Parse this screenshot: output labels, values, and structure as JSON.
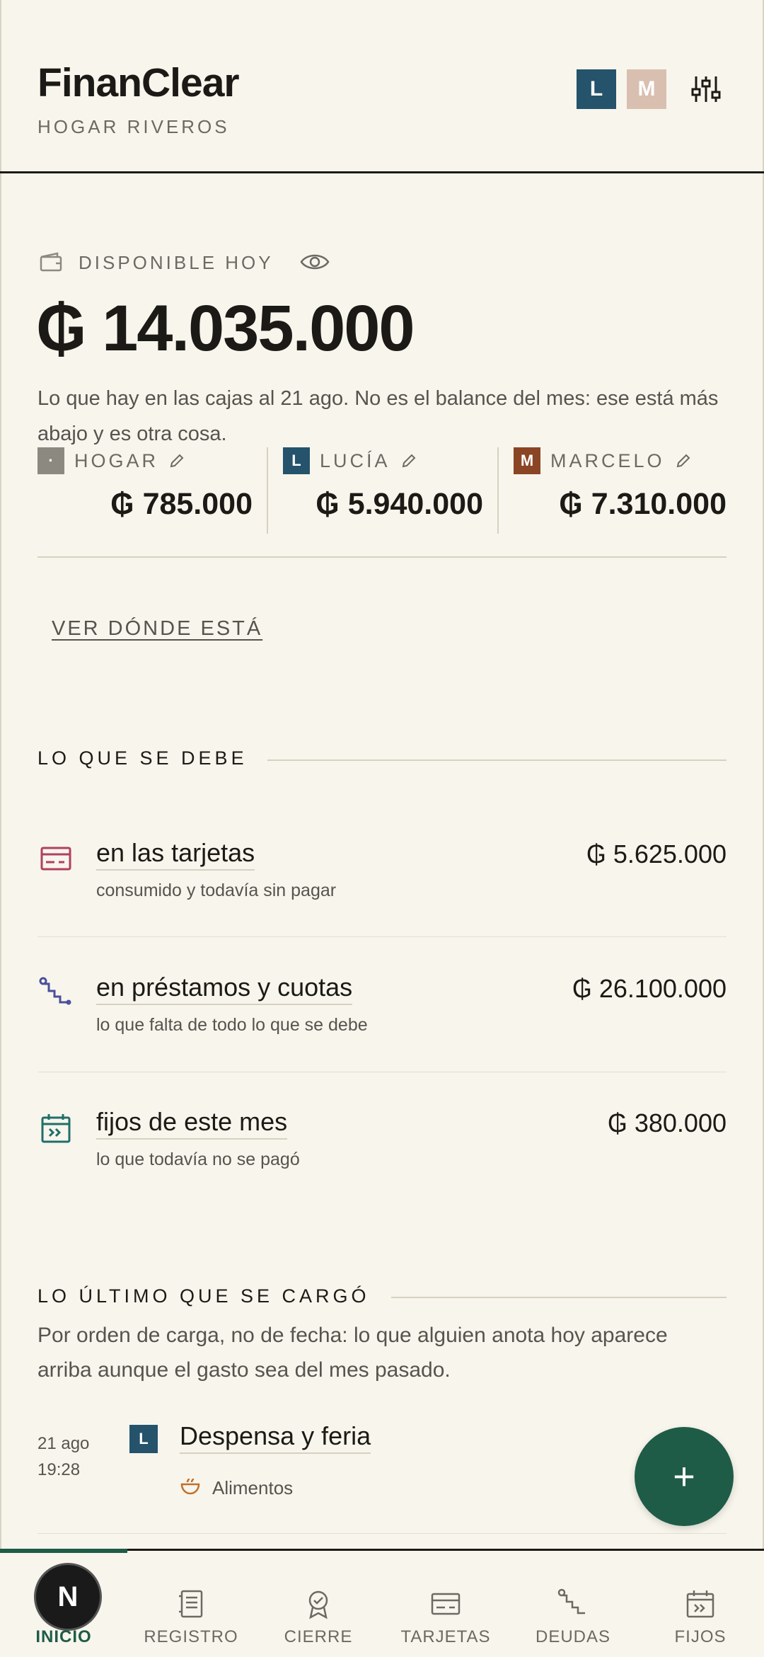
{
  "header": {
    "app_title": "FinanClear",
    "household": "HOGAR RIVEROS",
    "avatars": [
      "L",
      "M"
    ],
    "settings_icon": "sliders-icon"
  },
  "available": {
    "label": "DISPONIBLE HOY",
    "amount": "₲ 14.035.000",
    "note": "Lo que hay en las cajas al 21 ago. No es el balance del mes: ese está más abajo y es otra cosa.",
    "boxes": [
      {
        "badge": "·",
        "name": "HOGAR",
        "amount": "₲ 785.000",
        "color": "#8c8a80"
      },
      {
        "badge": "L",
        "name": "LUCÍA",
        "amount": "₲ 5.940.000",
        "color": "#24536b"
      },
      {
        "badge": "M",
        "name": "MARCELO",
        "amount": "₲ 7.310.000",
        "color": "#8a4524"
      }
    ],
    "see_where": "VER DÓNDE ESTÁ"
  },
  "debts": {
    "title": "LO QUE SE DEBE",
    "items": [
      {
        "title": "en las tarjetas",
        "subtitle": "consumido y todavía sin pagar",
        "amount": "₲ 5.625.000",
        "icon": "credit-card-icon"
      },
      {
        "title": "en préstamos y cuotas",
        "subtitle": "lo que falta de todo lo que se debe",
        "amount": "₲ 26.100.000",
        "icon": "stairs-icon"
      },
      {
        "title": "fijos de este mes",
        "subtitle": "lo que todavía no se pagó",
        "amount": "₲ 380.000",
        "icon": "calendar-icon"
      }
    ]
  },
  "recent": {
    "title": "LO ÚLTIMO QUE SE CARGÓ",
    "note": "Por orden de carga, no de fecha: lo que alguien anota hoy aparece arriba aunque el gasto sea del mes pasado.",
    "transactions": [
      {
        "date": "21 ago",
        "time": "19:28",
        "user": "L",
        "title": "Despensa y feria",
        "category": "Alimentos"
      }
    ]
  },
  "fab": {
    "label": "+"
  },
  "nav": {
    "badge": "N",
    "items": [
      {
        "label": "INICIO"
      },
      {
        "label": "REGISTRO"
      },
      {
        "label": "CIERRE"
      },
      {
        "label": "TARJETAS"
      },
      {
        "label": "DEUDAS"
      },
      {
        "label": "FIJOS"
      }
    ]
  },
  "colors": {
    "background": "#f8f5ec",
    "accent": "#1e5c48",
    "lucia": "#24536b",
    "marcelo": "#8a4524"
  }
}
